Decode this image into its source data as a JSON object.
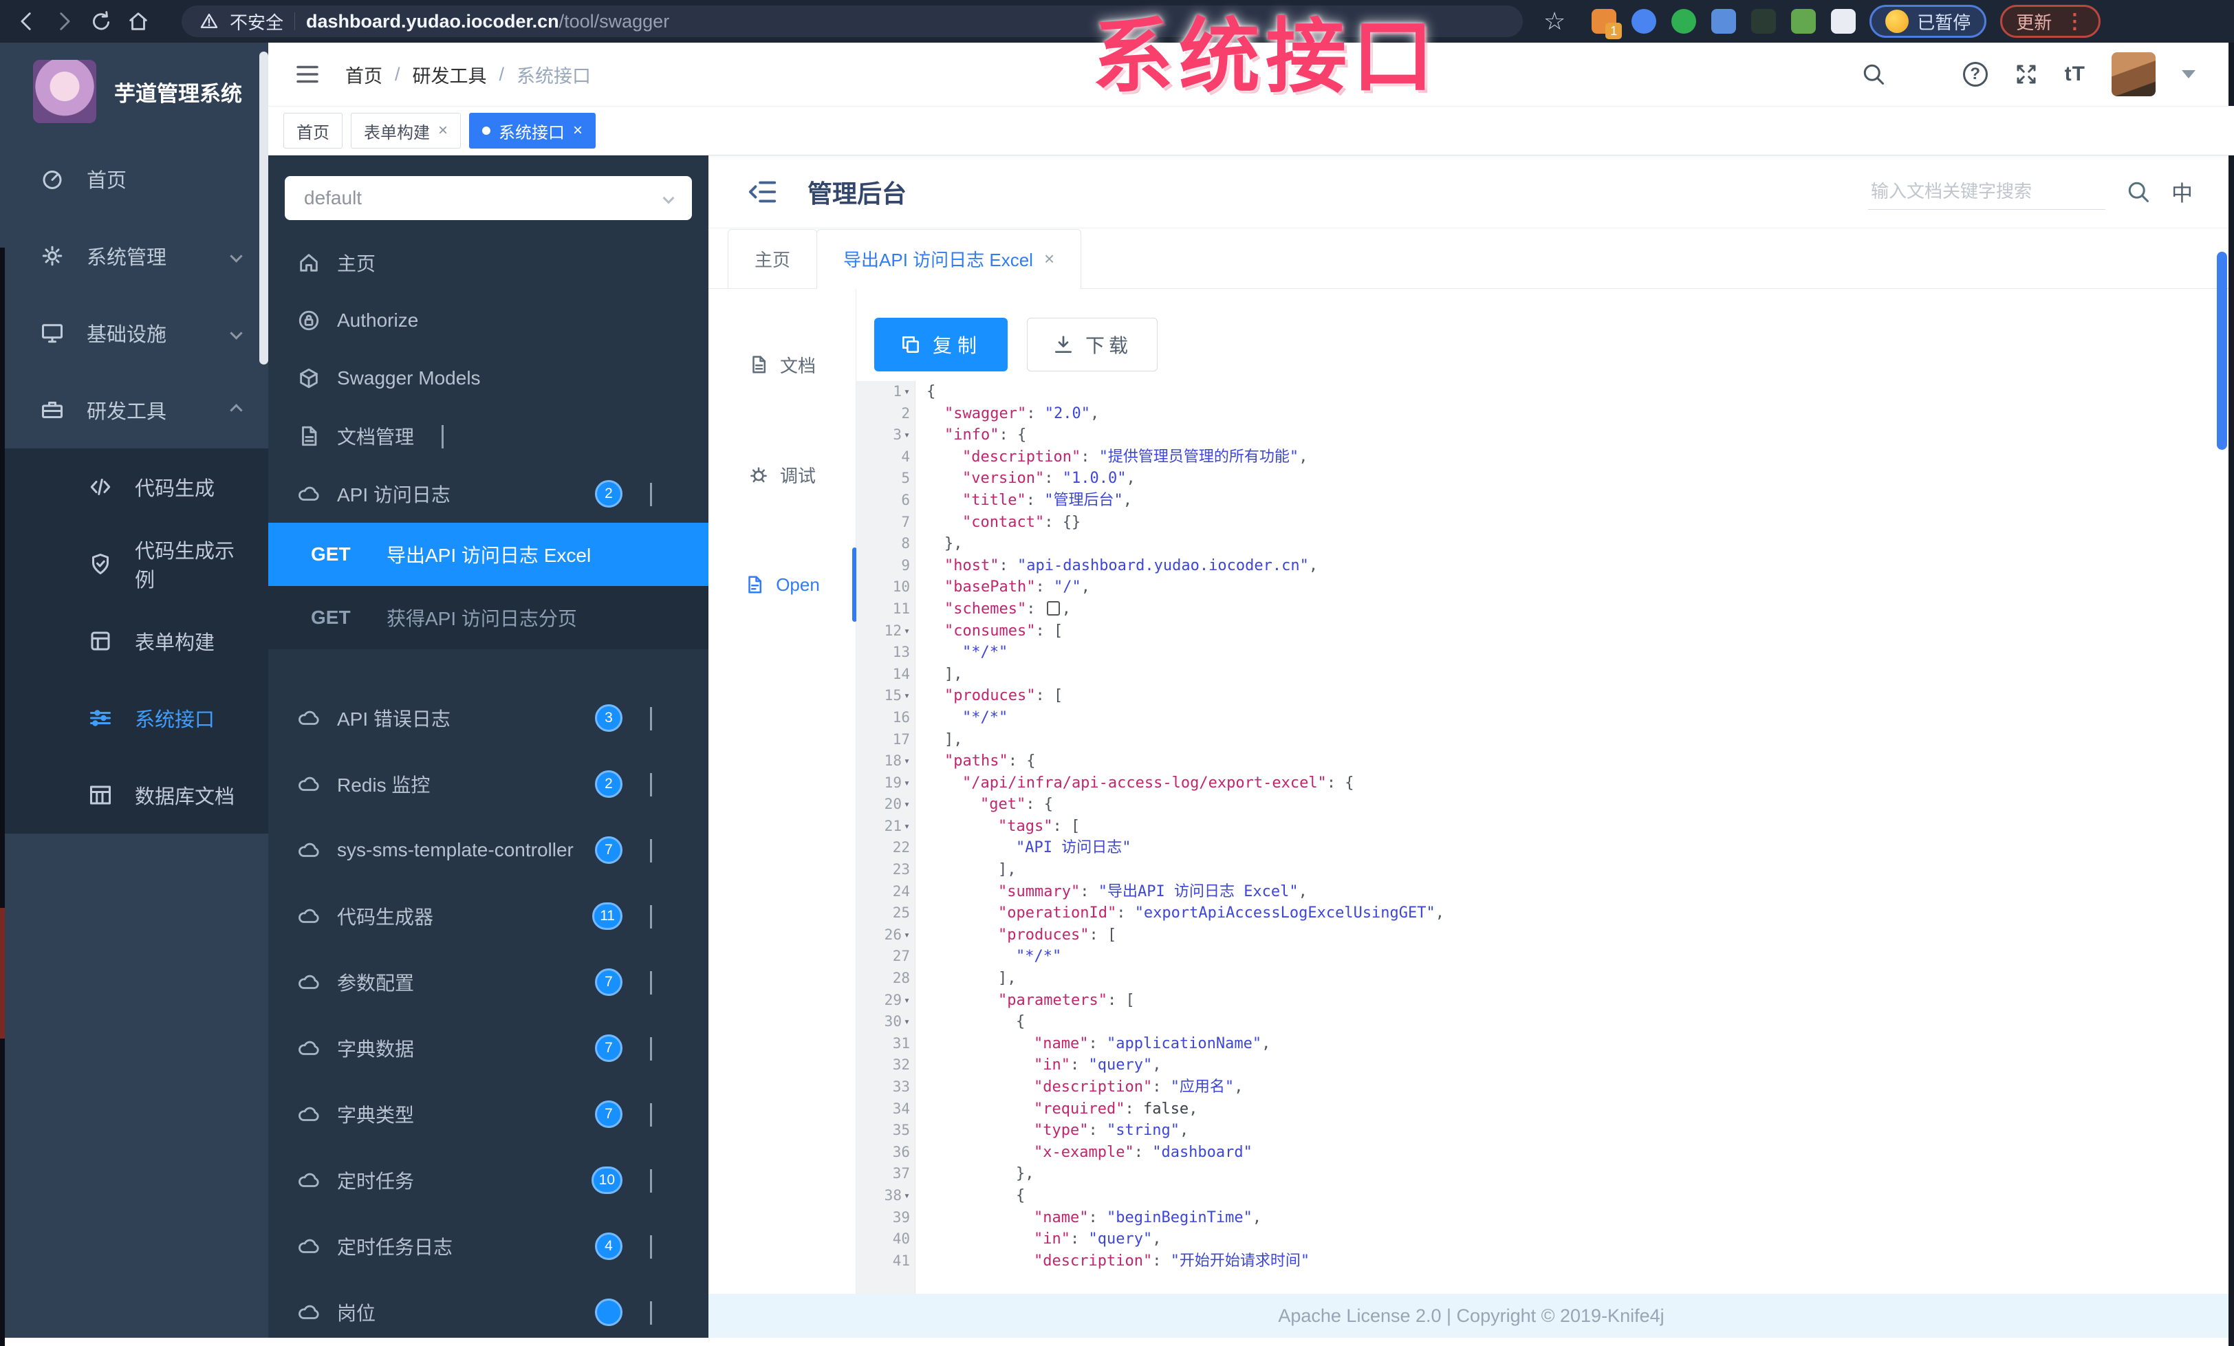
{
  "browser": {
    "security_label": "不安全",
    "url_host": "dashboard.yudao.iocoder.cn",
    "url_path": "/tool/swagger",
    "paused_label": "已暂停",
    "update_label": "更新",
    "ext_badge": "1",
    "extensions": [
      {
        "name": "extension-orange",
        "color": "#e78b3a",
        "badge": "1"
      },
      {
        "name": "extension-blue-drop",
        "color": "#4a84f0"
      },
      {
        "name": "extension-green-circle",
        "color": "#2fae52"
      },
      {
        "name": "extension-blue-grid",
        "color": "#5a8ddb"
      },
      {
        "name": "extension-dark-gn",
        "color": "#2a3b33"
      },
      {
        "name": "extension-green-leaf",
        "color": "#63a84e"
      },
      {
        "name": "extension-white-star",
        "color": "#e9edf3"
      }
    ]
  },
  "watermark": "系统接口",
  "glyphs": {
    "star": "☆",
    "dots": "⋮",
    "close": "×",
    "lang": "中",
    "font_size": "tT",
    "slash": "/",
    "question": "?",
    "fold": "▾",
    "dot": "•"
  },
  "sidebar": {
    "app_title": "芋道管理系统",
    "items": [
      {
        "label": "首页",
        "icon": "dashboard"
      },
      {
        "label": "系统管理",
        "icon": "gear",
        "chevron": "down"
      },
      {
        "label": "基础设施",
        "icon": "monitor",
        "chevron": "down"
      },
      {
        "label": "研发工具",
        "icon": "toolbox",
        "chevron": "up"
      }
    ],
    "subitems": [
      {
        "label": "代码生成",
        "icon": "code"
      },
      {
        "label": "代码生成示例",
        "icon": "shield"
      },
      {
        "label": "表单构建",
        "icon": "form"
      },
      {
        "label": "系统接口",
        "icon": "sliders",
        "active": true
      },
      {
        "label": "数据库文档",
        "icon": "table"
      }
    ]
  },
  "header": {
    "breadcrumb": [
      {
        "label": "首页"
      },
      {
        "label": "研发工具"
      },
      {
        "label": "系统接口",
        "muted": true
      }
    ]
  },
  "tags": [
    {
      "label": "首页"
    },
    {
      "label": "表单构建",
      "closable": true
    },
    {
      "label": "系统接口",
      "closable": true,
      "active": true
    }
  ],
  "swagger": {
    "group_value": "default",
    "menu": [
      {
        "label": "主页",
        "icon": "home"
      },
      {
        "label": "Authorize",
        "icon": "lock"
      },
      {
        "label": "Swagger Models",
        "icon": "models"
      },
      {
        "label": "文档管理",
        "icon": "file",
        "chevron": "down"
      },
      {
        "label": "API 访问日志",
        "icon": "cloud",
        "badge": "2",
        "chevron": "up"
      }
    ],
    "operations": [
      {
        "method": "GET",
        "label": "导出API 访问日志 Excel",
        "active": true
      },
      {
        "method": "GET",
        "label": "获得API 访问日志分页"
      }
    ],
    "groups": [
      {
        "label": "API 错误日志",
        "icon": "cloud",
        "badge": "3",
        "chevron": "down"
      },
      {
        "label": "Redis 监控",
        "icon": "cloud",
        "badge": "2",
        "chevron": "down"
      },
      {
        "label": "sys-sms-template-controller",
        "icon": "cloud",
        "badge": "7",
        "chevron": "down"
      },
      {
        "label": "代码生成器",
        "icon": "cloud",
        "badge": "11",
        "chevron": "down"
      },
      {
        "label": "参数配置",
        "icon": "cloud",
        "badge": "7",
        "chevron": "down"
      },
      {
        "label": "字典数据",
        "icon": "cloud",
        "badge": "7",
        "chevron": "down"
      },
      {
        "label": "字典类型",
        "icon": "cloud",
        "badge": "7",
        "chevron": "down"
      },
      {
        "label": "定时任务",
        "icon": "cloud",
        "badge": "10",
        "chevron": "down"
      },
      {
        "label": "定时任务日志",
        "icon": "cloud",
        "badge": "4",
        "chevron": "down"
      },
      {
        "label": "岗位",
        "icon": "cloud",
        "badge": "",
        "chevron": "down"
      }
    ]
  },
  "panel": {
    "title": "管理后台",
    "search_placeholder": "输入文档关键字搜索",
    "doc_tabs": [
      {
        "label": "主页"
      },
      {
        "label": "导出API 访问日志 Excel",
        "closable": true,
        "active": true
      }
    ],
    "rail": [
      {
        "label": "文档",
        "icon": "file"
      },
      {
        "label": "调试",
        "icon": "bug"
      },
      {
        "label": "Open",
        "icon": "fileopen",
        "active": true
      }
    ],
    "copy_label": "复制",
    "download_label": "下载",
    "footer": "Apache License 2.0 | Copyright © 2019-Knife4j"
  },
  "code": {
    "lines": [
      {
        "n": 1,
        "f": 1,
        "i": 0,
        "t": [
          [
            "p",
            "{"
          ]
        ]
      },
      {
        "n": 2,
        "i": 1,
        "t": [
          [
            "k",
            "\"swagger\""
          ],
          [
            "p",
            ": "
          ],
          [
            "s",
            "\"2.0\""
          ],
          [
            "p",
            ","
          ]
        ]
      },
      {
        "n": 3,
        "f": 1,
        "i": 1,
        "t": [
          [
            "k",
            "\"info\""
          ],
          [
            "p",
            ": {"
          ]
        ]
      },
      {
        "n": 4,
        "i": 2,
        "t": [
          [
            "k",
            "\"description\""
          ],
          [
            "p",
            ": "
          ],
          [
            "s",
            "\"提供管理员管理的所有功能\""
          ],
          [
            "p",
            ","
          ]
        ]
      },
      {
        "n": 5,
        "i": 2,
        "t": [
          [
            "k",
            "\"version\""
          ],
          [
            "p",
            ": "
          ],
          [
            "s",
            "\"1.0.0\""
          ],
          [
            "p",
            ","
          ]
        ]
      },
      {
        "n": 6,
        "i": 2,
        "t": [
          [
            "k",
            "\"title\""
          ],
          [
            "p",
            ": "
          ],
          [
            "s",
            "\"管理后台\""
          ],
          [
            "p",
            ","
          ]
        ]
      },
      {
        "n": 7,
        "i": 2,
        "t": [
          [
            "k",
            "\"contact\""
          ],
          [
            "p",
            ": {}"
          ]
        ]
      },
      {
        "n": 8,
        "i": 1,
        "t": [
          [
            "p",
            "},"
          ]
        ]
      },
      {
        "n": 9,
        "i": 1,
        "t": [
          [
            "k",
            "\"host\""
          ],
          [
            "p",
            ": "
          ],
          [
            "s",
            "\"api-dashboard.yudao.iocoder.cn\""
          ],
          [
            "p",
            ","
          ]
        ]
      },
      {
        "n": 10,
        "i": 1,
        "t": [
          [
            "k",
            "\"basePath\""
          ],
          [
            "p",
            ": "
          ],
          [
            "s",
            "\"/\""
          ],
          [
            "p",
            ","
          ]
        ]
      },
      {
        "n": 11,
        "i": 1,
        "t": [
          [
            "k",
            "\"schemes\""
          ],
          [
            "p",
            ": "
          ],
          [
            "x",
            ""
          ],
          [
            "p",
            ","
          ]
        ]
      },
      {
        "n": 12,
        "f": 1,
        "i": 1,
        "t": [
          [
            "k",
            "\"consumes\""
          ],
          [
            "p",
            ": ["
          ]
        ]
      },
      {
        "n": 13,
        "i": 2,
        "t": [
          [
            "s",
            "\"*/*\""
          ]
        ]
      },
      {
        "n": 14,
        "i": 1,
        "t": [
          [
            "p",
            "],"
          ]
        ]
      },
      {
        "n": 15,
        "f": 1,
        "i": 1,
        "t": [
          [
            "k",
            "\"produces\""
          ],
          [
            "p",
            ": ["
          ]
        ]
      },
      {
        "n": 16,
        "i": 2,
        "t": [
          [
            "s",
            "\"*/*\""
          ]
        ]
      },
      {
        "n": 17,
        "i": 1,
        "t": [
          [
            "p",
            "],"
          ]
        ]
      },
      {
        "n": 18,
        "f": 1,
        "i": 1,
        "t": [
          [
            "k",
            "\"paths\""
          ],
          [
            "p",
            ": {"
          ]
        ]
      },
      {
        "n": 19,
        "f": 1,
        "i": 2,
        "t": [
          [
            "k",
            "\"/api/infra/api-access-log/export-excel\""
          ],
          [
            "p",
            ": {"
          ]
        ]
      },
      {
        "n": 20,
        "f": 1,
        "i": 3,
        "t": [
          [
            "k",
            "\"get\""
          ],
          [
            "p",
            ": {"
          ]
        ]
      },
      {
        "n": 21,
        "f": 1,
        "i": 4,
        "t": [
          [
            "k",
            "\"tags\""
          ],
          [
            "p",
            ": ["
          ]
        ]
      },
      {
        "n": 22,
        "i": 5,
        "t": [
          [
            "s",
            "\"API 访问日志\""
          ]
        ]
      },
      {
        "n": 23,
        "i": 4,
        "t": [
          [
            "p",
            "],"
          ]
        ]
      },
      {
        "n": 24,
        "i": 4,
        "t": [
          [
            "k",
            "\"summary\""
          ],
          [
            "p",
            ": "
          ],
          [
            "s",
            "\"导出API 访问日志 Excel\""
          ],
          [
            "p",
            ","
          ]
        ]
      },
      {
        "n": 25,
        "i": 4,
        "t": [
          [
            "k",
            "\"operationId\""
          ],
          [
            "p",
            ": "
          ],
          [
            "s",
            "\"exportApiAccessLogExcelUsingGET\""
          ],
          [
            "p",
            ","
          ]
        ]
      },
      {
        "n": 26,
        "f": 1,
        "i": 4,
        "t": [
          [
            "k",
            "\"produces\""
          ],
          [
            "p",
            ": ["
          ]
        ]
      },
      {
        "n": 27,
        "i": 5,
        "t": [
          [
            "s",
            "\"*/*\""
          ]
        ]
      },
      {
        "n": 28,
        "i": 4,
        "t": [
          [
            "p",
            "],"
          ]
        ]
      },
      {
        "n": 29,
        "f": 1,
        "i": 4,
        "t": [
          [
            "k",
            "\"parameters\""
          ],
          [
            "p",
            ": ["
          ]
        ]
      },
      {
        "n": 30,
        "f": 1,
        "i": 5,
        "t": [
          [
            "p",
            "{"
          ]
        ]
      },
      {
        "n": 31,
        "i": 6,
        "t": [
          [
            "k",
            "\"name\""
          ],
          [
            "p",
            ": "
          ],
          [
            "s",
            "\"applicationName\""
          ],
          [
            "p",
            ","
          ]
        ]
      },
      {
        "n": 32,
        "i": 6,
        "t": [
          [
            "k",
            "\"in\""
          ],
          [
            "p",
            ": "
          ],
          [
            "s",
            "\"query\""
          ],
          [
            "p",
            ","
          ]
        ]
      },
      {
        "n": 33,
        "i": 6,
        "t": [
          [
            "k",
            "\"description\""
          ],
          [
            "p",
            ": "
          ],
          [
            "s",
            "\"应用名\""
          ],
          [
            "p",
            ","
          ]
        ]
      },
      {
        "n": 34,
        "i": 6,
        "t": [
          [
            "k",
            "\"required\""
          ],
          [
            "p",
            ": "
          ],
          [
            "b",
            "false"
          ],
          [
            "p",
            ","
          ]
        ]
      },
      {
        "n": 35,
        "i": 6,
        "t": [
          [
            "k",
            "\"type\""
          ],
          [
            "p",
            ": "
          ],
          [
            "s",
            "\"string\""
          ],
          [
            "p",
            ","
          ]
        ]
      },
      {
        "n": 36,
        "i": 6,
        "t": [
          [
            "k",
            "\"x-example\""
          ],
          [
            "p",
            ": "
          ],
          [
            "s",
            "\"dashboard\""
          ]
        ]
      },
      {
        "n": 37,
        "i": 5,
        "t": [
          [
            "p",
            "},"
          ]
        ]
      },
      {
        "n": 38,
        "f": 1,
        "i": 5,
        "t": [
          [
            "p",
            "{"
          ]
        ]
      },
      {
        "n": 39,
        "i": 6,
        "t": [
          [
            "k",
            "\"name\""
          ],
          [
            "p",
            ": "
          ],
          [
            "s",
            "\"beginBeginTime\""
          ],
          [
            "p",
            ","
          ]
        ]
      },
      {
        "n": 40,
        "i": 6,
        "t": [
          [
            "k",
            "\"in\""
          ],
          [
            "p",
            ": "
          ],
          [
            "s",
            "\"query\""
          ],
          [
            "p",
            ","
          ]
        ]
      },
      {
        "n": 41,
        "i": 6,
        "t": [
          [
            "k",
            "\"description\""
          ],
          [
            "p",
            ": "
          ],
          [
            "s",
            "\"开始开始请求时间\""
          ]
        ]
      }
    ]
  }
}
